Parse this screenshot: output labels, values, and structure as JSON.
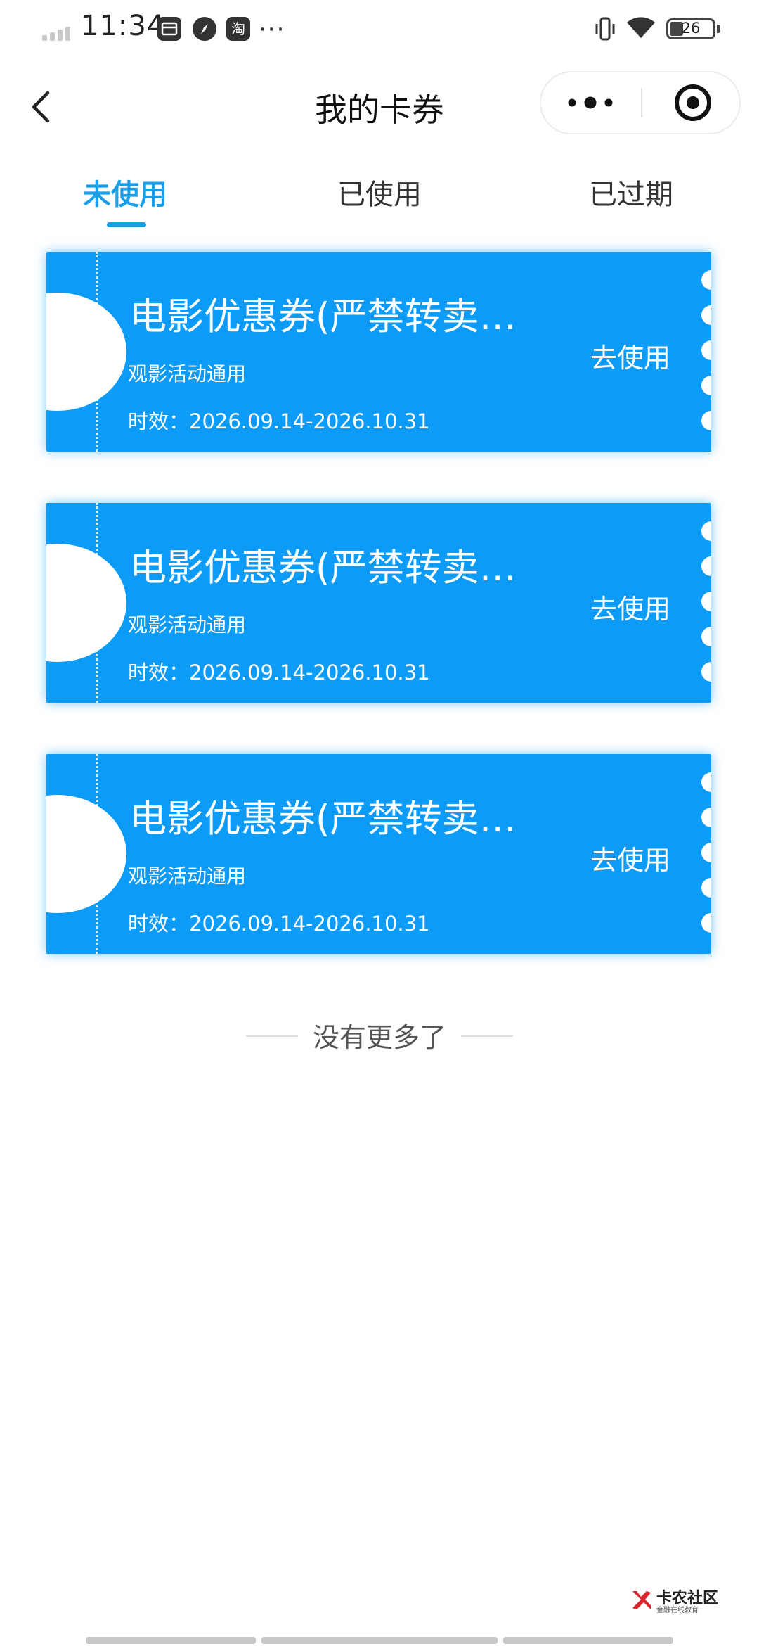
{
  "status_bar": {
    "time": "11:34",
    "battery_level": "26",
    "app_icon_label": "淘",
    "more_dots": "···"
  },
  "nav": {
    "title": "我的卡券"
  },
  "tabs": [
    {
      "label": "未使用",
      "active": true
    },
    {
      "label": "已使用",
      "active": false
    },
    {
      "label": "已过期",
      "active": false
    }
  ],
  "coupons": [
    {
      "title": "电影优惠券(严禁转卖…",
      "subtitle": "观影活动通用",
      "validity": "时效：2026.09.14-2026.10.31",
      "action": "去使用"
    },
    {
      "title": "电影优惠券(严禁转卖…",
      "subtitle": "观影活动通用",
      "validity": "时效：2026.09.14-2026.10.31",
      "action": "去使用"
    },
    {
      "title": "电影优惠券(严禁转卖…",
      "subtitle": "观影活动通用",
      "validity": "时效：2026.09.14-2026.10.31",
      "action": "去使用"
    }
  ],
  "list_end_text": "没有更多了",
  "watermark": {
    "name": "卡农社区",
    "tagline": "金融在线教育"
  },
  "colors": {
    "accent": "#1a9ee8",
    "coupon": "#0c9bf6"
  }
}
